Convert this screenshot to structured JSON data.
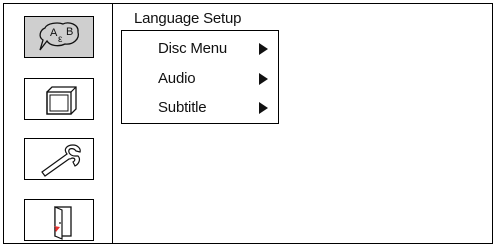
{
  "header": {
    "title": "Language Setup"
  },
  "menu": {
    "items": [
      {
        "label": "Disc Menu"
      },
      {
        "label": "Audio"
      },
      {
        "label": "Subtitle"
      }
    ]
  },
  "sidebar": {
    "icons": [
      {
        "name": "language-icon",
        "text": "A B ε",
        "selected": true
      },
      {
        "name": "screen-icon"
      },
      {
        "name": "wrench-icon"
      },
      {
        "name": "exit-door-icon"
      }
    ]
  }
}
